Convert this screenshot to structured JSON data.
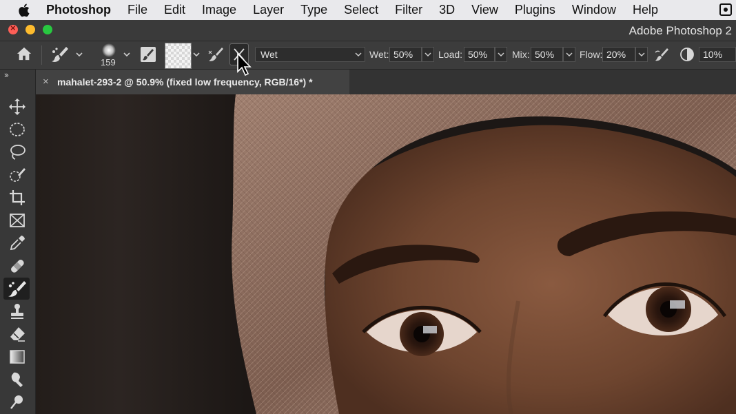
{
  "menubar": {
    "app_name": "Photoshop",
    "items": [
      "File",
      "Edit",
      "Image",
      "Layer",
      "Type",
      "Select",
      "Filter",
      "3D",
      "View",
      "Plugins",
      "Window",
      "Help"
    ]
  },
  "window": {
    "title": "Adobe Photoshop 2"
  },
  "options_bar": {
    "brush_size": "159",
    "blend_preset": "Wet",
    "wet_label": "Wet:",
    "wet_value": "50%",
    "load_label": "Load:",
    "load_value": "50%",
    "mix_label": "Mix:",
    "mix_value": "50%",
    "flow_label": "Flow:",
    "flow_value": "20%",
    "smoothing_value": "10%"
  },
  "document": {
    "tab_title": "mahalet-293-2 @ 50.9% (fixed low frequency, RGB/16*) *",
    "close_glyph": "×"
  },
  "toolbar": {
    "collapse_glyph": "››",
    "tools": [
      "move-tool",
      "elliptical-marquee-tool",
      "lasso-tool",
      "quick-selection-tool",
      "crop-tool",
      "frame-tool",
      "eyedropper-tool",
      "healing-brush-tool",
      "mixer-brush-tool",
      "clone-stamp-tool",
      "eraser-tool",
      "gradient-tool",
      "smudge-tool",
      "dodge-tool"
    ],
    "active_tool": "mixer-brush-tool"
  },
  "colors": {
    "menubar_bg": "#e9e9ec",
    "panel_bg": "#383838",
    "options_bg": "#3c3c3c",
    "close_red": "#fe5f57",
    "minimize_yellow": "#febc2e",
    "zoom_green": "#28c840"
  }
}
